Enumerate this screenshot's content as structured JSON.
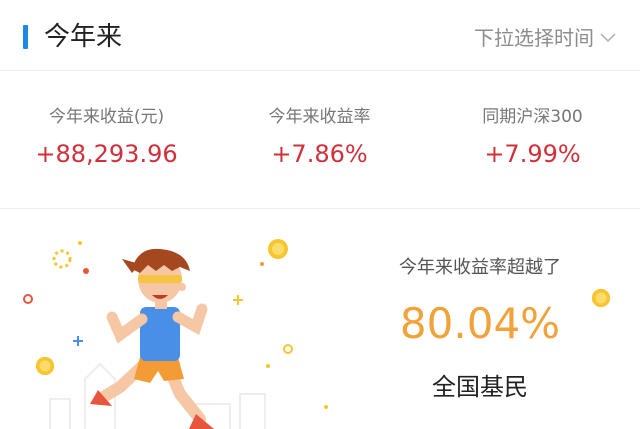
{
  "header": {
    "title": "今年来",
    "dropdown_label": "下拉选择时间"
  },
  "stats": [
    {
      "label": "今年来收益(元)",
      "value": "+88,293.96"
    },
    {
      "label": "今年来收益率",
      "value": "+7.86%"
    },
    {
      "label": "同期沪深300",
      "value": "+7.99%"
    }
  ],
  "promo": {
    "subtitle": "今年来收益率超越了",
    "percent": "80.04%",
    "label": "全国基民"
  },
  "colors": {
    "accent_blue": "#1e88e5",
    "positive_red": "#d0303a",
    "highlight_orange": "#f2a23a"
  },
  "icons": [
    "chevron-down-icon",
    "runner-illustration",
    "coin-icon",
    "sparkle-icon",
    "city-skyline-icon"
  ]
}
